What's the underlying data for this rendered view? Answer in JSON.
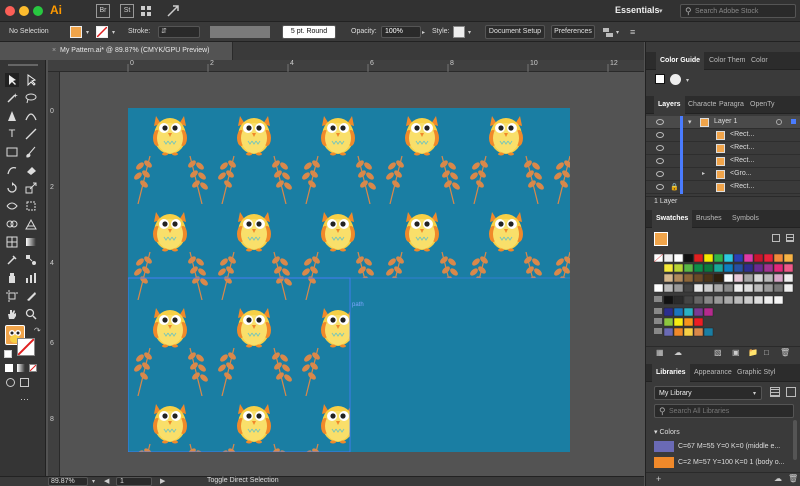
{
  "app": {
    "logo": "Ai",
    "bridge": "Br",
    "stock": "St",
    "workspace": "Essentials",
    "search_placeholder": "Search Adobe Stock"
  },
  "control_bar": {
    "selection": "No Selection",
    "stroke_label": "Stroke:",
    "brush": "5 pt. Round",
    "opacity_label": "Opacity:",
    "opacity_value": "100%",
    "style_label": "Style:",
    "doc_setup": "Document Setup",
    "preferences": "Preferences"
  },
  "document": {
    "tab_title": "My Pattern.ai* @ 89.87% (CMYK/GPU Preview)",
    "ruler_top": [
      "0",
      "2",
      "4",
      "6",
      "8",
      "10",
      "12"
    ],
    "ruler_left": [
      "0",
      "2",
      "4",
      "6",
      "8"
    ],
    "path_label": "path"
  },
  "status": {
    "zoom": "89.87%",
    "page": "1",
    "tool_hint": "Toggle Direct Selection"
  },
  "panels": {
    "color_guide_tabs": [
      "Color Guide",
      "Color Them",
      "Color"
    ],
    "layers_tabs": [
      "Layers",
      "Characte",
      "Paragra",
      "OpenTy"
    ],
    "layers": [
      {
        "name": "Layer 1",
        "level": 0
      },
      {
        "name": "<Rect...",
        "level": 1
      },
      {
        "name": "<Rect...",
        "level": 1
      },
      {
        "name": "<Rect...",
        "level": 1
      },
      {
        "name": "<Gro...",
        "level": 1
      },
      {
        "name": "<Rect...",
        "level": 1
      }
    ],
    "layers_footer": "1 Layer",
    "swatch_tabs": [
      "Swatches",
      "Brushes",
      "Symbols"
    ],
    "library_tabs": [
      "Libraries",
      "Appearance",
      "Graphic Styl"
    ],
    "library_name": "My Library",
    "library_search_placeholder": "Search All Libraries",
    "colors_header": "Colors",
    "colors": [
      {
        "label": "C=67 M=55 Y=0 K=0 (middle e...",
        "hex": "#6a6ab5"
      },
      {
        "label": "C=2 M=57 Y=100 K=0 1 (body o...",
        "hex": "#f0892a"
      }
    ]
  },
  "colors": {
    "pattern_bg": "#1a7ea3",
    "owl_body": "#f7d046",
    "owl_ears": "#f0892a",
    "leaf": "#d9884a",
    "selection": "#4a7cff"
  }
}
